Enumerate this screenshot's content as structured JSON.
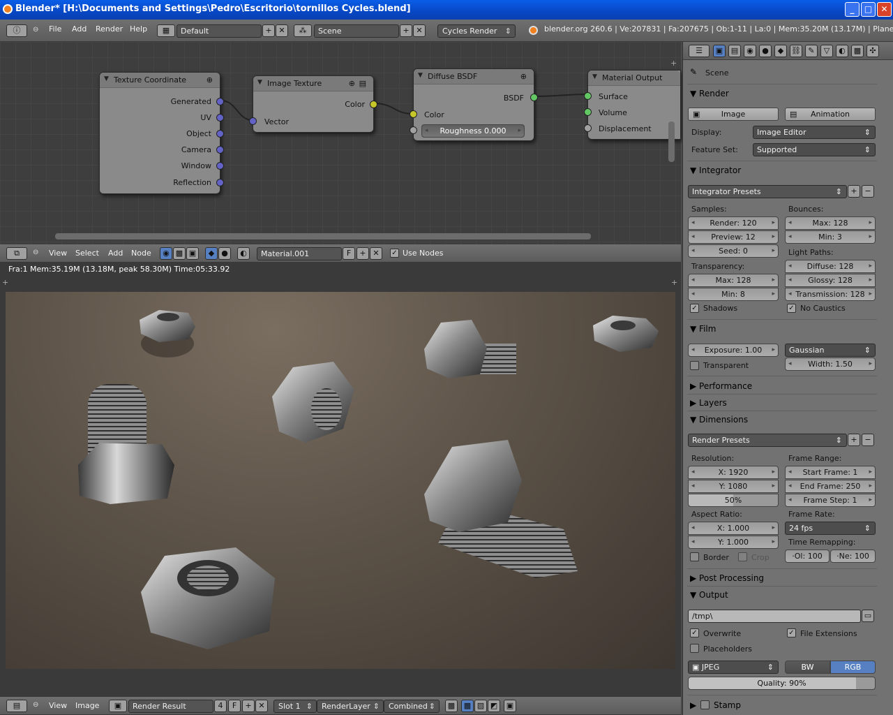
{
  "window": {
    "title": "Blender* [H:\\Documents and Settings\\Pedro\\Escritorio\\tornillos Cycles.blend]",
    "buttons": [
      "_",
      "□",
      "✕"
    ]
  },
  "info_header": {
    "menus": [
      "File",
      "Add",
      "Render",
      "Help"
    ],
    "layout": "Default",
    "scene": "Scene",
    "engine": "Cycles Render",
    "stats": "blender.org 260.6 | Ve:207831 | Fa:207675 | Ob:1-11 | La:0 | Mem:35.20M (13.17M) | Plane"
  },
  "nodes": {
    "texture_coordinate": {
      "title": "Texture Coordinate",
      "outputs": [
        "Generated",
        "UV",
        "Object",
        "Camera",
        "Window",
        "Reflection"
      ]
    },
    "image_texture": {
      "title": "Image Texture",
      "output": "Color",
      "input": "Vector"
    },
    "diffuse_bsdf": {
      "title": "Diffuse BSDF",
      "output": "BSDF",
      "input": "Color",
      "roughness": "Roughness 0.000"
    },
    "material_output": {
      "title": "Material Output",
      "inputs": [
        "Surface",
        "Volume",
        "Displacement"
      ]
    }
  },
  "node_header": {
    "menus": [
      "View",
      "Select",
      "Add",
      "Node"
    ],
    "material": "Material.001",
    "f_label": "F",
    "use_nodes": "Use Nodes"
  },
  "image_editor": {
    "info": "Fra:1  Mem:35.19M (13.18M, peak 58.30M) Time:05:33.92",
    "menus": [
      "View",
      "Image"
    ],
    "image": "Render Result",
    "users": "4",
    "f_label": "F",
    "slot": "Slot 1",
    "layer": "RenderLayer",
    "pass": "Combined"
  },
  "properties": {
    "context": "Scene",
    "render": {
      "title": "Render",
      "image_btn": "Image",
      "animation_btn": "Animation",
      "display_label": "Display:",
      "display": "Image Editor",
      "feature_label": "Feature Set:",
      "feature": "Supported"
    },
    "integrator": {
      "title": "Integrator",
      "presets": "Integrator Presets",
      "samples_label": "Samples:",
      "render": "Render: 120",
      "preview": "Preview: 12",
      "seed": "Seed: 0",
      "bounces_label": "Bounces:",
      "max": "Max: 128",
      "min": "Min: 3",
      "light_paths_label": "Light Paths:",
      "diffuse": "Diffuse: 128",
      "glossy": "Glossy: 128",
      "transmission": "Transmission: 128",
      "transparency_label": "Transparency:",
      "t_max": "Max: 128",
      "t_min": "Min: 8",
      "shadows": "Shadows",
      "no_caustics": "No Caustics"
    },
    "film": {
      "title": "Film",
      "exposure": "Exposure: 1.00",
      "filter": "Gaussian",
      "width": "Width: 1.50",
      "transparent": "Transparent"
    },
    "performance": "Performance",
    "layers": "Layers",
    "dimensions": {
      "title": "Dimensions",
      "presets": "Render Presets",
      "resolution_label": "Resolution:",
      "x": "X: 1920",
      "y": "Y: 1080",
      "percent": "50%",
      "percent_value": 0.5,
      "frame_range_label": "Frame Range:",
      "start": "Start Frame: 1",
      "end": "End Frame: 250",
      "step": "Frame Step: 1",
      "aspect_label": "Aspect Ratio:",
      "ax": "X: 1.000",
      "ay": "Y: 1.000",
      "frame_rate_label": "Frame Rate:",
      "fps": "24 fps",
      "remap_label": "Time Remapping:",
      "old": "·Ol: 100",
      "new": "·Ne: 100",
      "border": "Border",
      "crop": "Crop"
    },
    "post_processing": "Post Processing",
    "output": {
      "title": "Output",
      "path": "/tmp\\",
      "overwrite": "Overwrite",
      "file_extensions": "File Extensions",
      "placeholders": "Placeholders",
      "format": "JPEG",
      "bw": "BW",
      "rgb": "RGB",
      "quality": "Quality: 90%",
      "quality_value": 0.9
    },
    "stamp": "Stamp"
  },
  "colors": {
    "title_bar": "#0a5ee8",
    "selected_button": "#5680c2"
  }
}
